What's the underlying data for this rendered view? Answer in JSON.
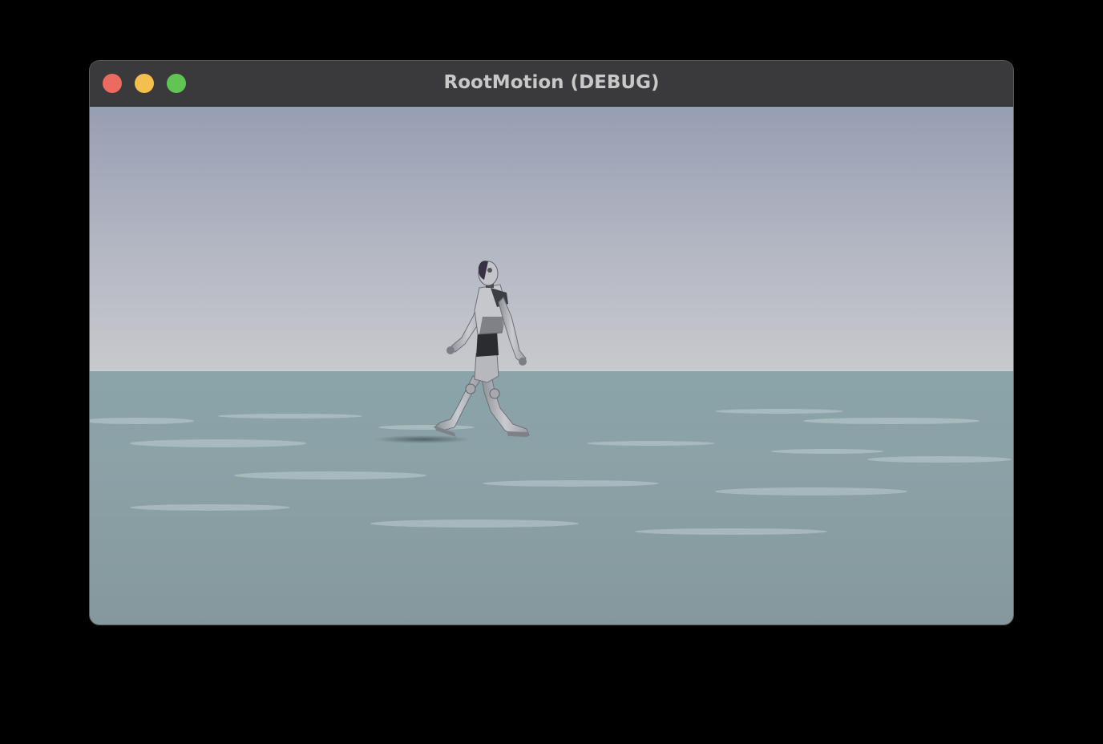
{
  "window": {
    "title": "RootMotion (DEBUG)",
    "controls": [
      {
        "name": "close-button",
        "color": "#ec6a5f"
      },
      {
        "name": "minimize-button",
        "color": "#f4bf4f"
      },
      {
        "name": "zoom-button",
        "color": "#61c554"
      }
    ]
  },
  "scene": {
    "sky_top_color": "#979eb3",
    "sky_horizon_color": "#c8c9cd",
    "ground_near_color": "#85999d",
    "ground_far_color": "#8aa4a9",
    "character": "robot-mannequin-walking"
  }
}
